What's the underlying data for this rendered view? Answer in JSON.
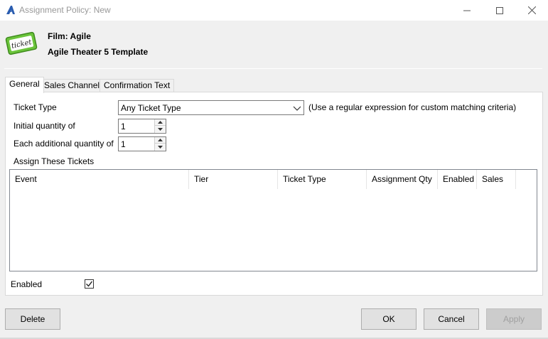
{
  "window": {
    "title": "Assignment Policy: New",
    "icons": {
      "app": "agile-a-logo-icon",
      "minimize": "minimize-icon",
      "maximize": "maximize-icon",
      "close": "close-icon"
    }
  },
  "header": {
    "film": "Film: Agile",
    "template": "Agile Theater 5 Template",
    "icon": "ticket-icon",
    "icon_text": "ticket"
  },
  "tabs": [
    {
      "label": "General",
      "active": true
    },
    {
      "label": "Sales Channels",
      "active": false
    },
    {
      "label": "Confirmation Text",
      "active": false
    }
  ],
  "general": {
    "ticket_type_label": "Ticket Type",
    "ticket_type_value": "Any Ticket Type",
    "ticket_type_hint": "(Use a regular expression for custom matching criteria)",
    "initial_qty_label": "Initial quantity of",
    "initial_qty_value": "1",
    "additional_qty_label": "Each additional quantity of",
    "additional_qty_value": "1",
    "assign_label": "Assign These Tickets",
    "columns": [
      "Event",
      "Tier",
      "Ticket Type",
      "Assignment Qty",
      "Enabled",
      "Sales"
    ],
    "rows": []
  },
  "enabled": {
    "label": "Enabled",
    "checked": true
  },
  "buttons": {
    "delete": "Delete",
    "ok": "OK",
    "cancel": "Cancel",
    "apply": "Apply"
  },
  "colors": {
    "ticket_green": "#6bc43b",
    "disabled_text": "#a0a0a0"
  }
}
